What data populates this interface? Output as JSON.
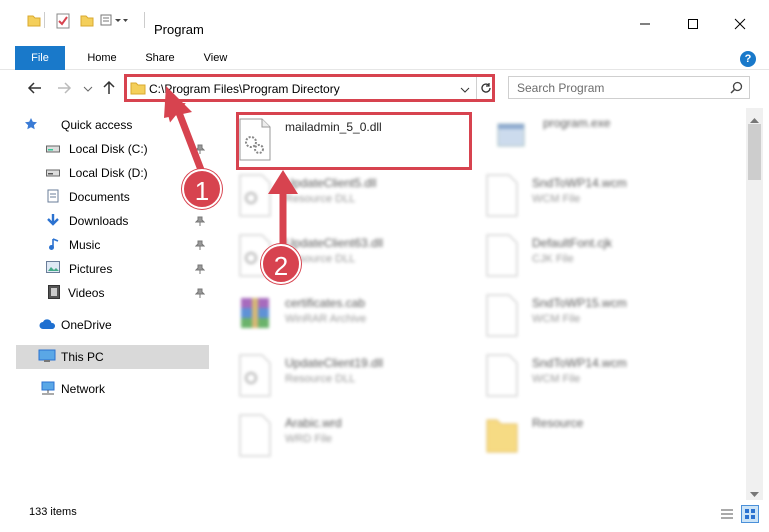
{
  "window": {
    "title": "Program"
  },
  "ribbon": {
    "tabs": [
      {
        "label": "File"
      },
      {
        "label": "Home"
      },
      {
        "label": "Share"
      },
      {
        "label": "View"
      }
    ]
  },
  "address": {
    "path": "C:\\Program Files\\Program Directory"
  },
  "search": {
    "placeholder": "Search Program"
  },
  "sidebar": {
    "items": [
      {
        "label": "Quick access",
        "icon": "star-icon"
      },
      {
        "label": "Local Disk (C:)",
        "icon": "drive-icon"
      },
      {
        "label": "Local Disk (D:)",
        "icon": "drive-icon"
      },
      {
        "label": "Documents",
        "icon": "documents-icon"
      },
      {
        "label": "Downloads",
        "icon": "download-icon"
      },
      {
        "label": "Music",
        "icon": "music-icon"
      },
      {
        "label": "Pictures",
        "icon": "pictures-icon"
      },
      {
        "label": "Videos",
        "icon": "videos-icon"
      },
      {
        "label": "OneDrive",
        "icon": "cloud-icon"
      },
      {
        "label": "This PC",
        "icon": "computer-icon"
      },
      {
        "label": "Network",
        "icon": "network-icon"
      }
    ]
  },
  "files": [
    {
      "name": "mailadmin_5_0.dll",
      "type": ""
    },
    {
      "name": "program.exe",
      "type": ""
    },
    {
      "name": "UpdateClient5.dll",
      "type": "Resource DLL"
    },
    {
      "name": "SndToWP14.wcm",
      "type": "WCM File"
    },
    {
      "name": "UpdateClient63.dll",
      "type": "Resource DLL"
    },
    {
      "name": "DefaultFont.cjk",
      "type": "CJK File"
    },
    {
      "name": "certificates.cab",
      "type": "WinRAR Archive"
    },
    {
      "name": "SndToWP15.wcm",
      "type": "WCM File"
    },
    {
      "name": "UpdateClient19.dll",
      "type": "Resource DLL"
    },
    {
      "name": "SndToWP14.wcm",
      "type": "WCM File"
    },
    {
      "name": "Arabic.wrd",
      "type": "WRD File"
    },
    {
      "name": "Resource",
      "type": ""
    }
  ],
  "status": {
    "items_count": "133 items"
  },
  "annotations": {
    "step1": "1",
    "step2": "2"
  },
  "colors": {
    "accent": "#1979ca",
    "highlight": "#d7434f",
    "selection": "#cce8ff"
  }
}
